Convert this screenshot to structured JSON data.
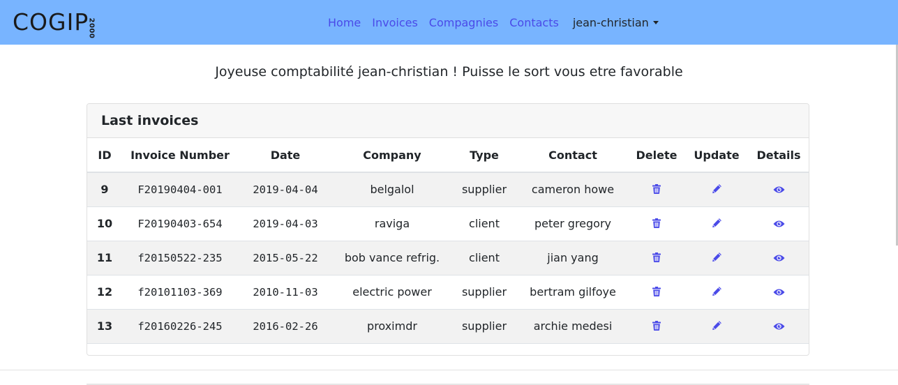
{
  "navbar": {
    "brand": "COGIP",
    "brand_year": "2000",
    "links": [
      "Home",
      "Invoices",
      "Compagnies",
      "Contacts"
    ],
    "user": "jean-christian",
    "bg_color": "#78b4ff",
    "link_color": "#4a4ae8"
  },
  "welcome": "Joyeuse comptabilité jean-christian ! Puisse le sort vous etre favorable",
  "invoices": {
    "title": "Last invoices",
    "columns": [
      "ID",
      "Invoice Number",
      "Date",
      "Company",
      "Type",
      "Contact",
      "Delete",
      "Update",
      "Details"
    ],
    "rows": [
      {
        "id": "9",
        "number": "F20190404-001",
        "date": "2019-04-04",
        "company": "belgalol",
        "type": "supplier",
        "contact": "cameron howe"
      },
      {
        "id": "10",
        "number": "F20190403-654",
        "date": "2019-04-03",
        "company": "raviga",
        "type": "client",
        "contact": "peter gregory"
      },
      {
        "id": "11",
        "number": "f20150522-235",
        "date": "2015-05-22",
        "company": "bob vance refrig.",
        "type": "client",
        "contact": "jian yang"
      },
      {
        "id": "12",
        "number": "f20101103-369",
        "date": "2010-11-03",
        "company": "electric power",
        "type": "supplier",
        "contact": "bertram gilfoye"
      },
      {
        "id": "13",
        "number": "f20160226-245",
        "date": "2016-02-26",
        "company": "proximdr",
        "type": "supplier",
        "contact": "archie medesi"
      }
    ],
    "icons": {
      "delete": "trash-icon",
      "update": "pencil-icon",
      "details": "eye-icon"
    },
    "icon_color": "#4a4ae8"
  }
}
